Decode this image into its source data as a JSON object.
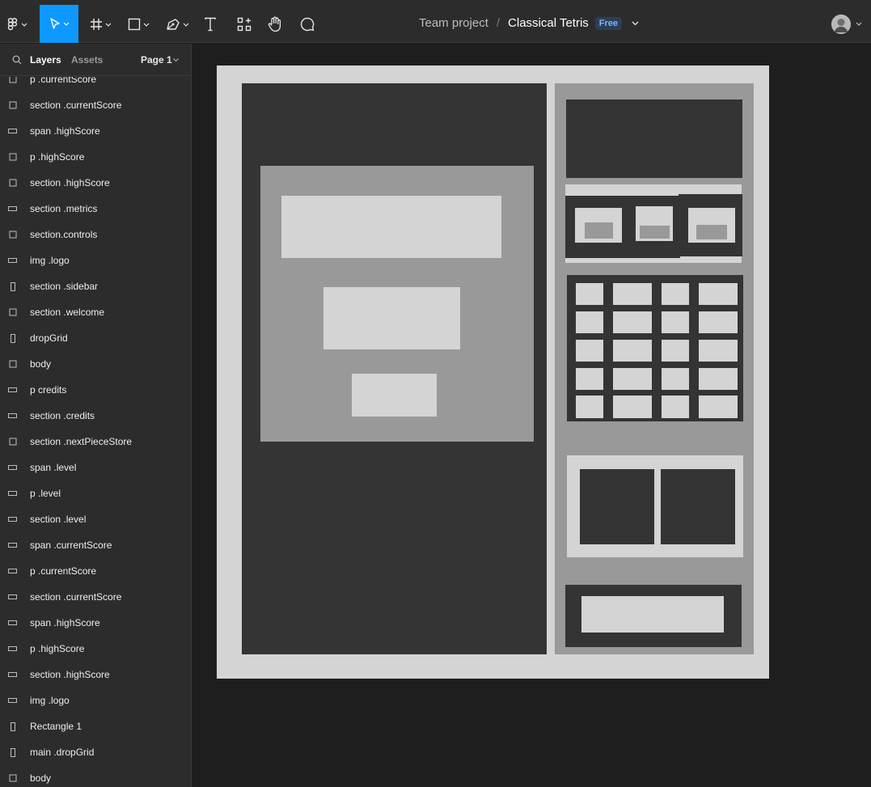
{
  "toolbar": {
    "tools": [
      "main-menu-icon",
      "move-icon",
      "frame-icon",
      "rectangle-icon",
      "pen-icon",
      "text-icon",
      "resources-icon",
      "hand-icon",
      "comment-icon"
    ],
    "project": "Team project",
    "separator": "/",
    "file_name": "Classical Tetris",
    "plan_badge": "Free"
  },
  "sidebar": {
    "tabs": {
      "layers": "Layers",
      "assets": "Assets"
    },
    "page": "Page 1",
    "layers": [
      {
        "label": "p .currentScore",
        "icon": "text-layer-icon"
      },
      {
        "label": "section .currentScore",
        "icon": "frame-layer-icon"
      },
      {
        "label": "span .highScore",
        "icon": "rect-layer-icon"
      },
      {
        "label": "p .highScore",
        "icon": "frame-layer-icon"
      },
      {
        "label": "section .highScore",
        "icon": "frame-layer-icon"
      },
      {
        "label": "section .metrics",
        "icon": "rect-layer-icon"
      },
      {
        "label": "section.controls",
        "icon": "frame-layer-icon"
      },
      {
        "label": "img .logo",
        "icon": "rect-layer-icon"
      },
      {
        "label": "section .sidebar",
        "icon": "tall-rect-layer-icon"
      },
      {
        "label": "section .welcome",
        "icon": "frame-layer-icon"
      },
      {
        "label": "dropGrid",
        "icon": "tall-rect-layer-icon"
      },
      {
        "label": "body",
        "icon": "frame-layer-icon"
      },
      {
        "label": "p credits",
        "icon": "rect-layer-icon"
      },
      {
        "label": "section .credits",
        "icon": "rect-layer-icon"
      },
      {
        "label": "section .nextPieceStore",
        "icon": "frame-layer-icon"
      },
      {
        "label": "span .level",
        "icon": "rect-layer-icon"
      },
      {
        "label": "p .level",
        "icon": "rect-layer-icon"
      },
      {
        "label": "section .level",
        "icon": "rect-layer-icon"
      },
      {
        "label": "span .currentScore",
        "icon": "rect-layer-icon"
      },
      {
        "label": "p .currentScore",
        "icon": "rect-layer-icon"
      },
      {
        "label": "section .currentScore",
        "icon": "rect-layer-icon"
      },
      {
        "label": "span .highScore",
        "icon": "rect-layer-icon"
      },
      {
        "label": "p .highScore",
        "icon": "rect-layer-icon"
      },
      {
        "label": "section .highScore",
        "icon": "rect-layer-icon"
      },
      {
        "label": "img .logo",
        "icon": "rect-layer-icon"
      },
      {
        "label": "Rectangle 1",
        "icon": "tall-rect-layer-icon"
      },
      {
        "label": "main .dropGrid",
        "icon": "tall-rect-layer-icon"
      },
      {
        "label": "body",
        "icon": "frame-layer-icon"
      }
    ]
  },
  "colors": {
    "accent": "#0d99ff",
    "canvas_bg": "#1e1e1e",
    "panel_bg": "#2c2c2c",
    "wireframe_light": "#d4d4d4",
    "wireframe_dark": "#343434",
    "wireframe_mid": "#999999"
  }
}
